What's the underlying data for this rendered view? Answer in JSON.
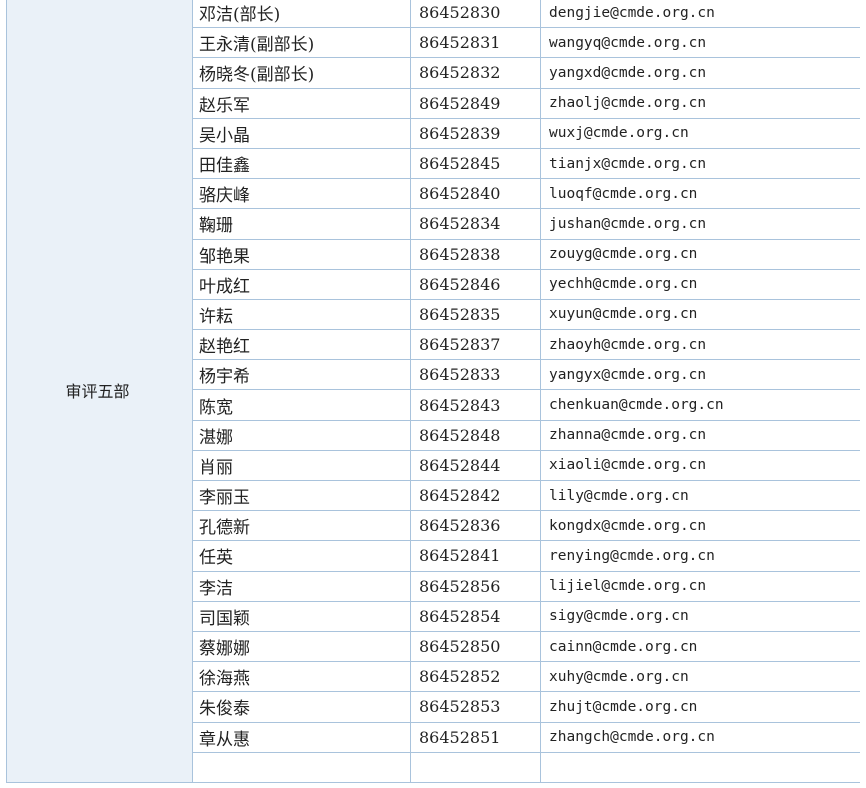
{
  "department": "审评五部",
  "rows": [
    {
      "name": "邓洁(部长)",
      "phone": "86452830",
      "email": "dengjie@cmde.org.cn"
    },
    {
      "name": "王永清(副部长)",
      "phone": "86452831",
      "email": "wangyq@cmde.org.cn"
    },
    {
      "name": "杨晓冬(副部长)",
      "phone": "86452832",
      "email": "yangxd@cmde.org.cn"
    },
    {
      "name": "赵乐军",
      "phone": "86452849",
      "email": "zhaolj@cmde.org.cn"
    },
    {
      "name": "吴小晶",
      "phone": "86452839",
      "email": "wuxj@cmde.org.cn"
    },
    {
      "name": "田佳鑫",
      "phone": "86452845",
      "email": "tianjx@cmde.org.cn"
    },
    {
      "name": "骆庆峰",
      "phone": "86452840",
      "email": "luoqf@cmde.org.cn"
    },
    {
      "name": "鞠珊",
      "phone": "86452834",
      "email": "jushan@cmde.org.cn"
    },
    {
      "name": "邹艳果",
      "phone": "86452838",
      "email": "zouyg@cmde.org.cn"
    },
    {
      "name": "叶成红",
      "phone": "86452846",
      "email": "yechh@cmde.org.cn"
    },
    {
      "name": "许耘",
      "phone": "86452835",
      "email": "xuyun@cmde.org.cn"
    },
    {
      "name": "赵艳红",
      "phone": "86452837",
      "email": "zhaoyh@cmde.org.cn"
    },
    {
      "name": "杨宇希",
      "phone": "86452833",
      "email": "yangyx@cmde.org.cn"
    },
    {
      "name": "陈宽",
      "phone": "86452843",
      "email": "chenkuan@cmde.org.cn"
    },
    {
      "name": "湛娜",
      "phone": "86452848",
      "email": "zhanna@cmde.org.cn"
    },
    {
      "name": "肖丽",
      "phone": "86452844",
      "email": "xiaoli@cmde.org.cn"
    },
    {
      "name": "李丽玉",
      "phone": "86452842",
      "email": "lily@cmde.org.cn"
    },
    {
      "name": "孔德新",
      "phone": "86452836",
      "email": "kongdx@cmde.org.cn"
    },
    {
      "name": "任英",
      "phone": "86452841",
      "email": "renying@cmde.org.cn"
    },
    {
      "name": "李洁",
      "phone": "86452856",
      "email": "lijiel@cmde.org.cn"
    },
    {
      "name": "司国颖",
      "phone": "86452854",
      "email": "sigy@cmde.org.cn"
    },
    {
      "name": "蔡娜娜",
      "phone": "86452850",
      "email": "cainn@cmde.org.cn"
    },
    {
      "name": "徐海燕",
      "phone": "86452852",
      "email": "xuhy@cmde.org.cn"
    },
    {
      "name": "朱俊泰",
      "phone": "86452853",
      "email": "zhujt@cmde.org.cn"
    },
    {
      "name": "章从惠",
      "phone": "86452851",
      "email": "zhangch@cmde.org.cn"
    }
  ]
}
